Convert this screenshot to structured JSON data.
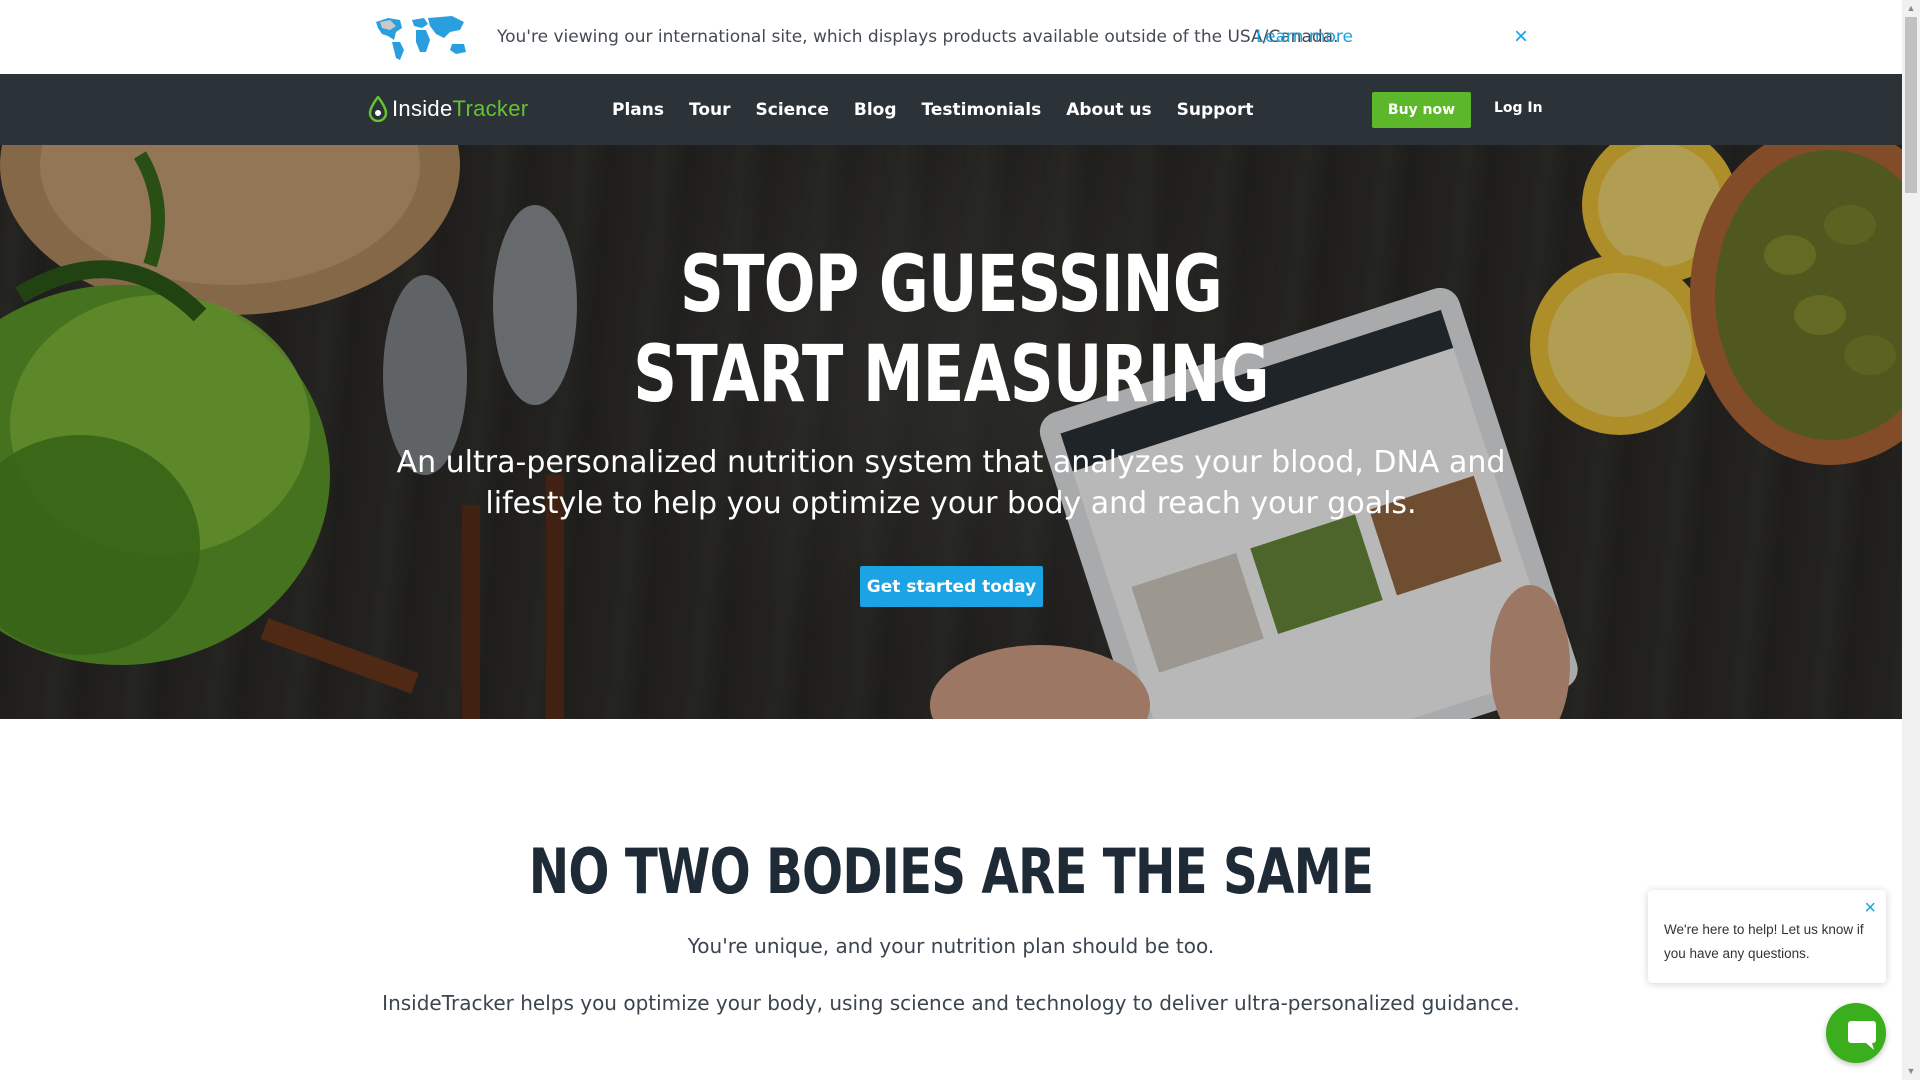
{
  "banner": {
    "text": "You're viewing our international site, which displays products available outside of the USA/Canada.",
    "link": "Learn more",
    "close_icon": "×"
  },
  "nav": {
    "logo_inside": "Inside",
    "logo_tracker": "Tracker",
    "links": [
      "Plans",
      "Tour",
      "Science",
      "Blog",
      "Testimonials",
      "About us",
      "Support"
    ],
    "buy": "Buy now",
    "login": "Log In"
  },
  "hero": {
    "title_line1": "STOP GUESSING",
    "title_line2": "START MEASURING",
    "subtitle": "An ultra-personalized nutrition system that analyzes your blood, DNA and lifestyle to help you optimize your body and reach your goals.",
    "cta": "Get started today"
  },
  "section": {
    "title": "NO TWO BODIES ARE THE SAME",
    "p1": "You're unique, and your nutrition plan should be too.",
    "p2": "InsideTracker helps you optimize your body, using science and technology to deliver ultra-personalized guidance."
  },
  "chat": {
    "message": "We're here to help! Let us know if you have any questions.",
    "close_icon": "×",
    "launcher_icon": "chat-icon"
  },
  "colors": {
    "nav_bg": "#2b3238",
    "brand_green": "#5cb82a",
    "accent_blue": "#1ba3e4",
    "chat_green": "#3aae1c"
  }
}
